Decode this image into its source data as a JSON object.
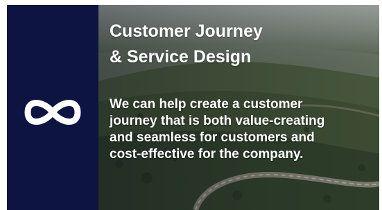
{
  "card": {
    "icon": "infinity-icon",
    "title_lines": [
      "Customer Journey",
      "& Service Design"
    ],
    "body_lines": [
      "We can help create a customer",
      "journey that is both value-creating",
      "and seamless for customers and",
      "cost-effective for the company."
    ],
    "colors": {
      "sidebar": "#0d1442",
      "text": "#ffffff"
    }
  }
}
